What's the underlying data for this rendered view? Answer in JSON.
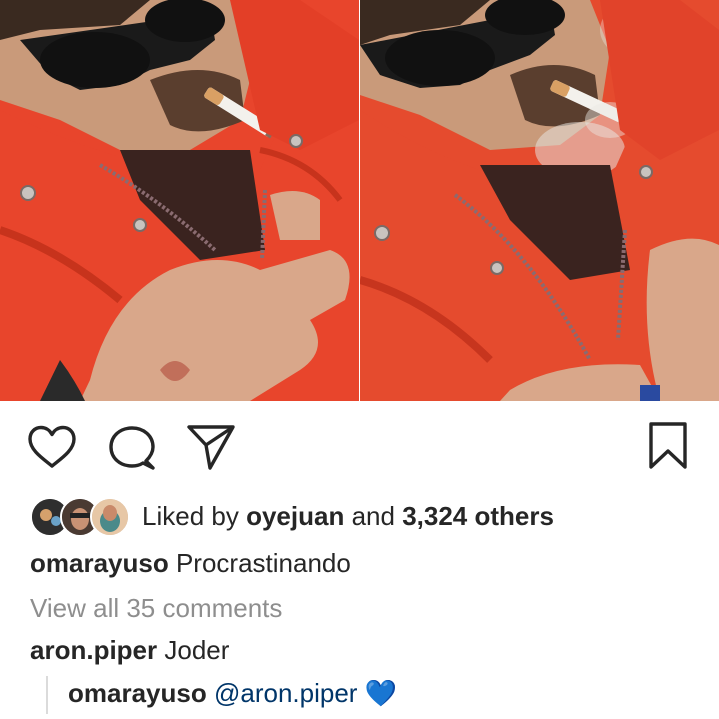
{
  "likes": {
    "prefix": "Liked by",
    "user": "oyejuan",
    "middle": "and",
    "count": "3,324 others"
  },
  "caption": {
    "username": "omarayuso",
    "text": "Procrastinando"
  },
  "view_comments": "View all 35 comments",
  "comments": [
    {
      "username": "aron.piper",
      "text": "Joder"
    }
  ],
  "reply": {
    "username": "omarayuso",
    "mention": "@aron.piper",
    "emoji": "💙"
  },
  "colors": {
    "jacket": "#e8452c",
    "text": "#262626",
    "muted": "#8e8e8e",
    "mention": "#003569",
    "heart_emoji": "#3b97e8"
  },
  "icons": [
    "heart-icon",
    "comment-icon",
    "share-icon",
    "bookmark-icon"
  ]
}
